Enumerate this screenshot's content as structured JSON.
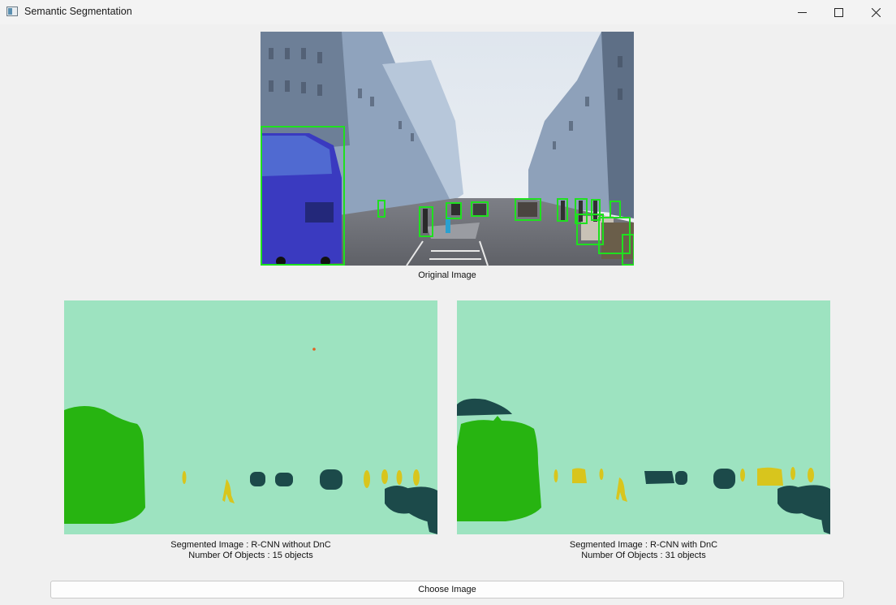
{
  "window": {
    "title": "Semantic Segmentation",
    "icons": [
      "app-icon",
      "minimize-icon",
      "maximize-icon",
      "close-icon"
    ]
  },
  "original": {
    "caption": "Original Image"
  },
  "segmented_left": {
    "caption_line1": "Segmented Image : R-CNN without DnC",
    "caption_line2": "Number Of Objects : 15 objects"
  },
  "segmented_right": {
    "caption_line1": "Segmented Image : R-CNN with DnC",
    "caption_line2": "Number Of Objects : 31 objects"
  },
  "controls": {
    "choose_label": "Choose Image"
  },
  "colors": {
    "background_class": "#9de3c0",
    "bus_class": "#27b411",
    "car_class": "#1c4a4a",
    "person_class": "#d8c51d",
    "detection_box": "#1fe01f"
  }
}
